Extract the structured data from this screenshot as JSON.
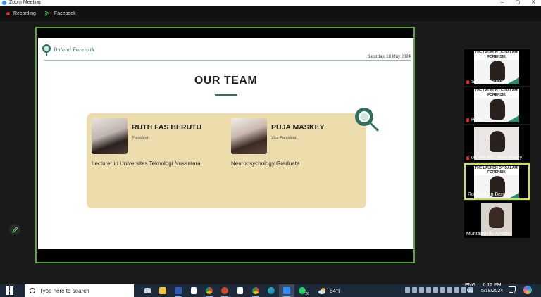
{
  "window": {
    "title": "Zoom Meeting",
    "controls": [
      "–",
      "▢",
      "✕"
    ]
  },
  "meeting_bar": {
    "recording_label": "Recording",
    "stream_label": "Facebook"
  },
  "slide": {
    "brand": "Dalami Forensik",
    "date": "Saturday, 18 May 2024",
    "heading": "OUR TEAM",
    "members": [
      {
        "name": "RUTH FAS BERUTU",
        "role": "President",
        "description": "Lecturer in Universitas Teknologi Nusantara"
      },
      {
        "name": "PUJA MASKEY",
        "role": "Vice President",
        "description": "Neuropsychology Graduate"
      }
    ]
  },
  "participants": [
    {
      "name": "Stefanie Buyung",
      "muted": true,
      "thumb_title": "THE LAUNCH OF DALAMI FORENSIK",
      "active": false
    },
    {
      "name": "Puja",
      "muted": true,
      "thumb_title": "THE LAUNCH OF DALAMI FORENSIK",
      "active": false
    },
    {
      "name": "04_PS KC_Rien Mercy",
      "muted": true,
      "thumb_title": "",
      "active": false
    },
    {
      "name": "Ruth Floren Berutu",
      "muted": false,
      "thumb_title": "THE LAUNCH OF DALAMI FORENSIK",
      "active": true
    },
    {
      "name": "Muntawakilu Amadu",
      "muted": false,
      "thumb_title": "",
      "active": false
    }
  ],
  "taskbar": {
    "search_placeholder": "Type here to search",
    "weather_temp": "84°F",
    "lang_line1": "ENG",
    "lang_line2": "US",
    "time": "6:12 PM",
    "date": "5/18/2024",
    "notification_count": "2",
    "whatsapp_badge": "26"
  },
  "colors": {
    "accent_green": "#5aa63a",
    "brand_teal": "#2f6f5f",
    "card_bg": "#ecdcab",
    "active_tile": "#c8e14c"
  }
}
